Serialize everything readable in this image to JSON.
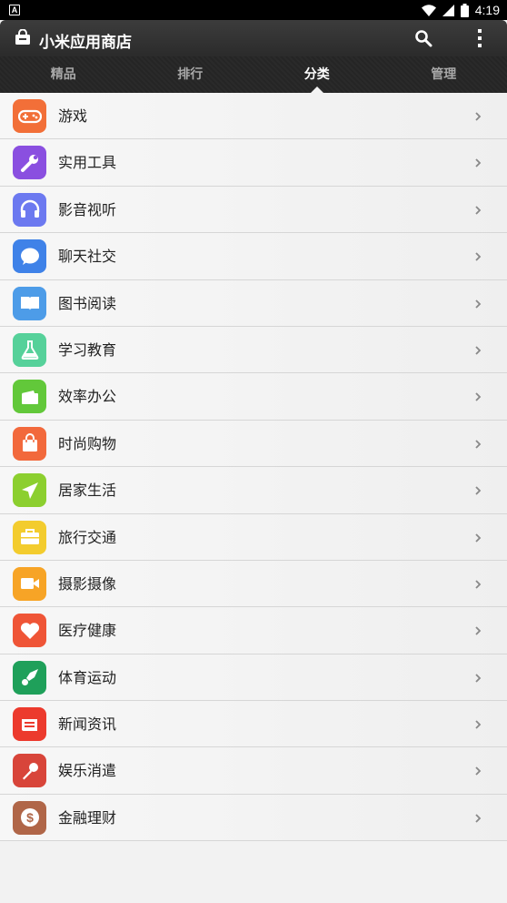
{
  "status_bar": {
    "time": "4:19",
    "notification_icon": "A"
  },
  "app_bar": {
    "title": "小米应用商店"
  },
  "tabs": [
    {
      "label": "精品",
      "active": false
    },
    {
      "label": "排行",
      "active": false
    },
    {
      "label": "分类",
      "active": true
    },
    {
      "label": "管理",
      "active": false
    }
  ],
  "categories": [
    {
      "label": "游戏",
      "icon": "gamepad-icon",
      "color": "#f26f38"
    },
    {
      "label": "实用工具",
      "icon": "wrench-icon",
      "color": "#8a4fe0"
    },
    {
      "label": "影音视听",
      "icon": "headphones-icon",
      "color": "#6c79f0"
    },
    {
      "label": "聊天社交",
      "icon": "chat-bubble-icon",
      "color": "#3f82e8"
    },
    {
      "label": "图书阅读",
      "icon": "book-icon",
      "color": "#4d9ce8"
    },
    {
      "label": "学习教育",
      "icon": "flask-icon",
      "color": "#56d19a"
    },
    {
      "label": "效率办公",
      "icon": "folder-icon",
      "color": "#62c83a"
    },
    {
      "label": "时尚购物",
      "icon": "shopping-bag-icon",
      "color": "#f2693c"
    },
    {
      "label": "居家生活",
      "icon": "paper-plane-icon",
      "color": "#8ccf2f"
    },
    {
      "label": "旅行交通",
      "icon": "suitcase-icon",
      "color": "#f3cc2e"
    },
    {
      "label": "摄影摄像",
      "icon": "video-camera-icon",
      "color": "#f7a426"
    },
    {
      "label": "医疗健康",
      "icon": "heart-icon",
      "color": "#ef5537"
    },
    {
      "label": "体育运动",
      "icon": "shuttlecock-icon",
      "color": "#1fa05a"
    },
    {
      "label": "新闻资讯",
      "icon": "newspaper-icon",
      "color": "#ec3a2d"
    },
    {
      "label": "娱乐消遣",
      "icon": "microphone-icon",
      "color": "#d8453a"
    },
    {
      "label": "金融理财",
      "icon": "dollar-coin-icon",
      "color": "#b06648"
    }
  ]
}
